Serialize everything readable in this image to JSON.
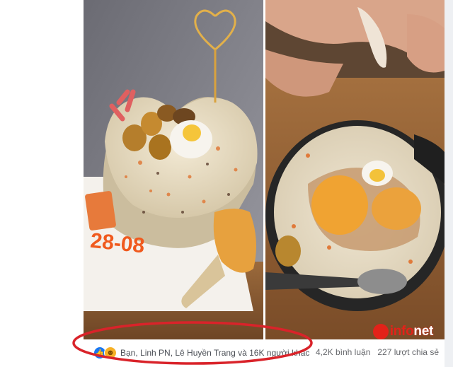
{
  "post": {
    "reactions": {
      "icons": [
        "like-icon",
        "haha-icon"
      ],
      "reactors_text": "Bạn, Linh PN, Lê Huyền Trang và 16K người khác"
    },
    "stats": {
      "comments": "4,2K bình luận",
      "shares": "227 lượt chia sẻ"
    },
    "photos": {
      "left": {
        "date_text": "28-08"
      }
    }
  },
  "watermark": {
    "brand_main": "info",
    "brand_alt": "net"
  },
  "colors": {
    "highlight": "#d9232a",
    "like": "#1877f2",
    "haha": "#f7b125",
    "brand": "#e32219"
  }
}
